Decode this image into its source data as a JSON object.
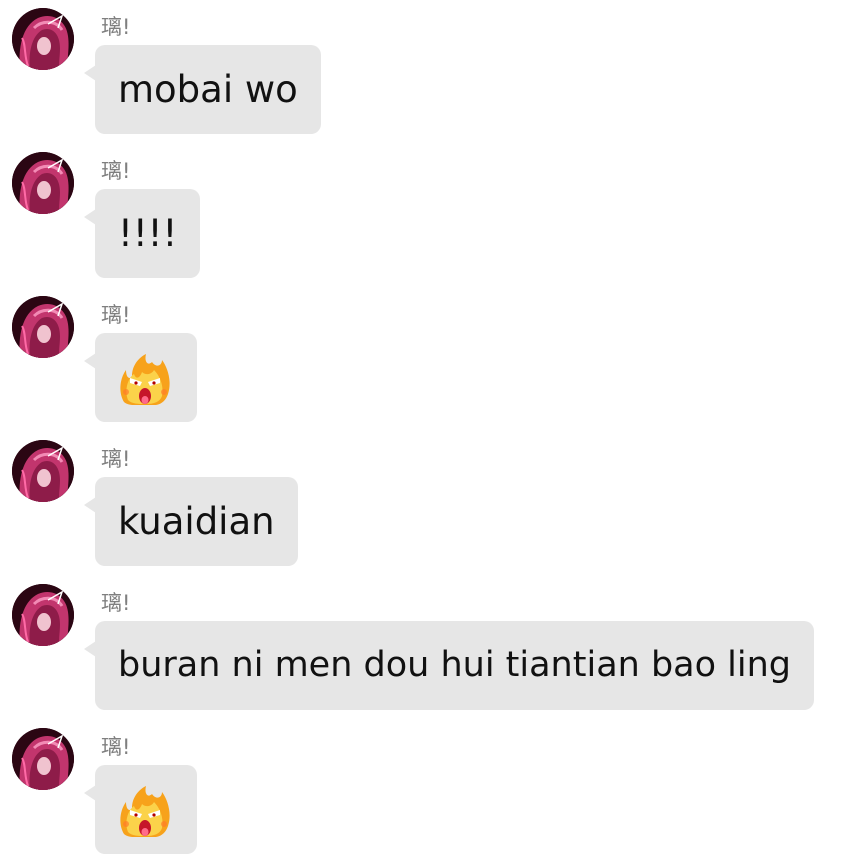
{
  "sender_name": "璃!",
  "messages": [
    {
      "type": "text",
      "text": "mobai wo"
    },
    {
      "type": "text",
      "text": "!!!!"
    },
    {
      "type": "sticker",
      "sticker": "angry-fire-face"
    },
    {
      "type": "text",
      "text": "kuaidian"
    },
    {
      "type": "text",
      "text": "buran ni men dou hui tiantian bao ling"
    },
    {
      "type": "sticker",
      "sticker": "angry-fire-face"
    }
  ],
  "colors": {
    "bubble": "#e6e6e6",
    "sender": "#7f7f7f",
    "text": "#111111",
    "avatar_hair": "#d23a78",
    "sticker_fire": "#f48a1e"
  }
}
